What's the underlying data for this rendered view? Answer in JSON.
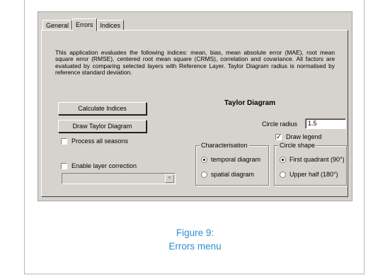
{
  "tabs": [
    {
      "label": "General",
      "active": false
    },
    {
      "label": "Errors",
      "active": true
    },
    {
      "label": "Indices",
      "active": false
    }
  ],
  "description": "This application evaluates the following indices: mean, bias, mean absolute error (MAE), root mean square error (RMSE), centered root mean square (CRMS), correlation and covariance. All factors are evaluated by comparing selected layers with Reference Layer. Taylor Diagram radius is normalised by reference standard deviation.",
  "taylor_diagram_title": "Taylor Diagram",
  "buttons": {
    "calculate": "Calculate Indices",
    "draw_taylor": "Draw Taylor Diagram"
  },
  "checkboxes": {
    "process_all_seasons": {
      "label": "Process all seasons",
      "checked": false
    },
    "enable_layer_correction": {
      "label": "Enable layer correction",
      "checked": false
    },
    "draw_legend": {
      "label": "Draw legend",
      "checked": true
    }
  },
  "circle_radius": {
    "label": "Circle radius",
    "value": "1.5"
  },
  "characterisation": {
    "title": "Characterisation",
    "options": [
      {
        "label": "temporal diagram",
        "selected": true
      },
      {
        "label": "spatial diagram",
        "selected": false
      }
    ]
  },
  "circle_shape": {
    "title": "Circle shape",
    "options": [
      {
        "label": "First quadrant (90°)",
        "selected": true
      },
      {
        "label": "Upper half (180°)",
        "selected": false
      }
    ]
  },
  "layer_select": {
    "value": ""
  },
  "caption": {
    "line1": "Figure 9:",
    "line2": "Errors menu"
  },
  "colors": {
    "dialog_bg": "#d6d3ce",
    "caption": "#2e8fcf"
  }
}
